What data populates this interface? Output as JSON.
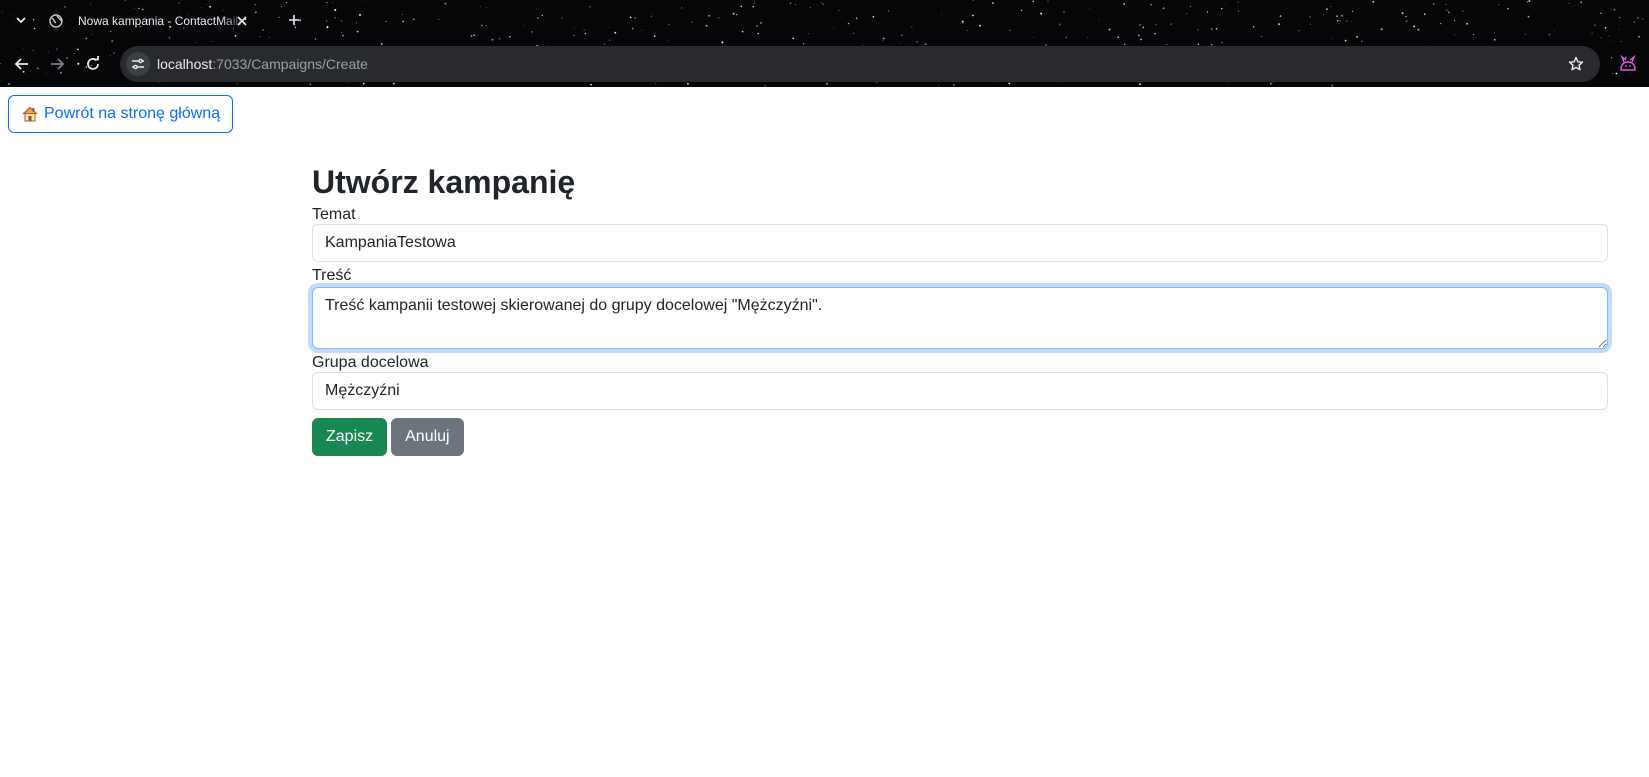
{
  "browser": {
    "tab_title": "Nowa kampania - ContactMailer",
    "url_host": "localhost",
    "url_rest": ":7033/Campaigns/Create",
    "icons": {
      "tab_list": "chevron-down-icon",
      "favicon": "globe-icon",
      "close_tab": "close-icon",
      "new_tab": "plus-icon",
      "back": "arrow-left-icon",
      "forward": "arrow-right-icon",
      "reload": "reload-icon",
      "site_info": "tune-icon",
      "bookmark": "star-icon",
      "profile": "profile-icon"
    }
  },
  "page": {
    "home_link_label": "Powrót na stronę główną",
    "title": "Utwórz kampanię",
    "form": {
      "subject_label": "Temat",
      "subject_value": "KampaniaTestowa",
      "content_label": "Treść",
      "content_value": "Treść kampanii testowej skierowanej do grupy docelowej \"Mężczyźni\".",
      "group_label": "Grupa docelowa",
      "group_value": "Mężczyźni"
    },
    "buttons": {
      "save_label": "Zapisz",
      "cancel_label": "Anuluj"
    }
  },
  "colors": {
    "primary": "#0d6efd",
    "success": "#198754",
    "secondary": "#6c757d",
    "focus_border": "#86b7fe"
  }
}
